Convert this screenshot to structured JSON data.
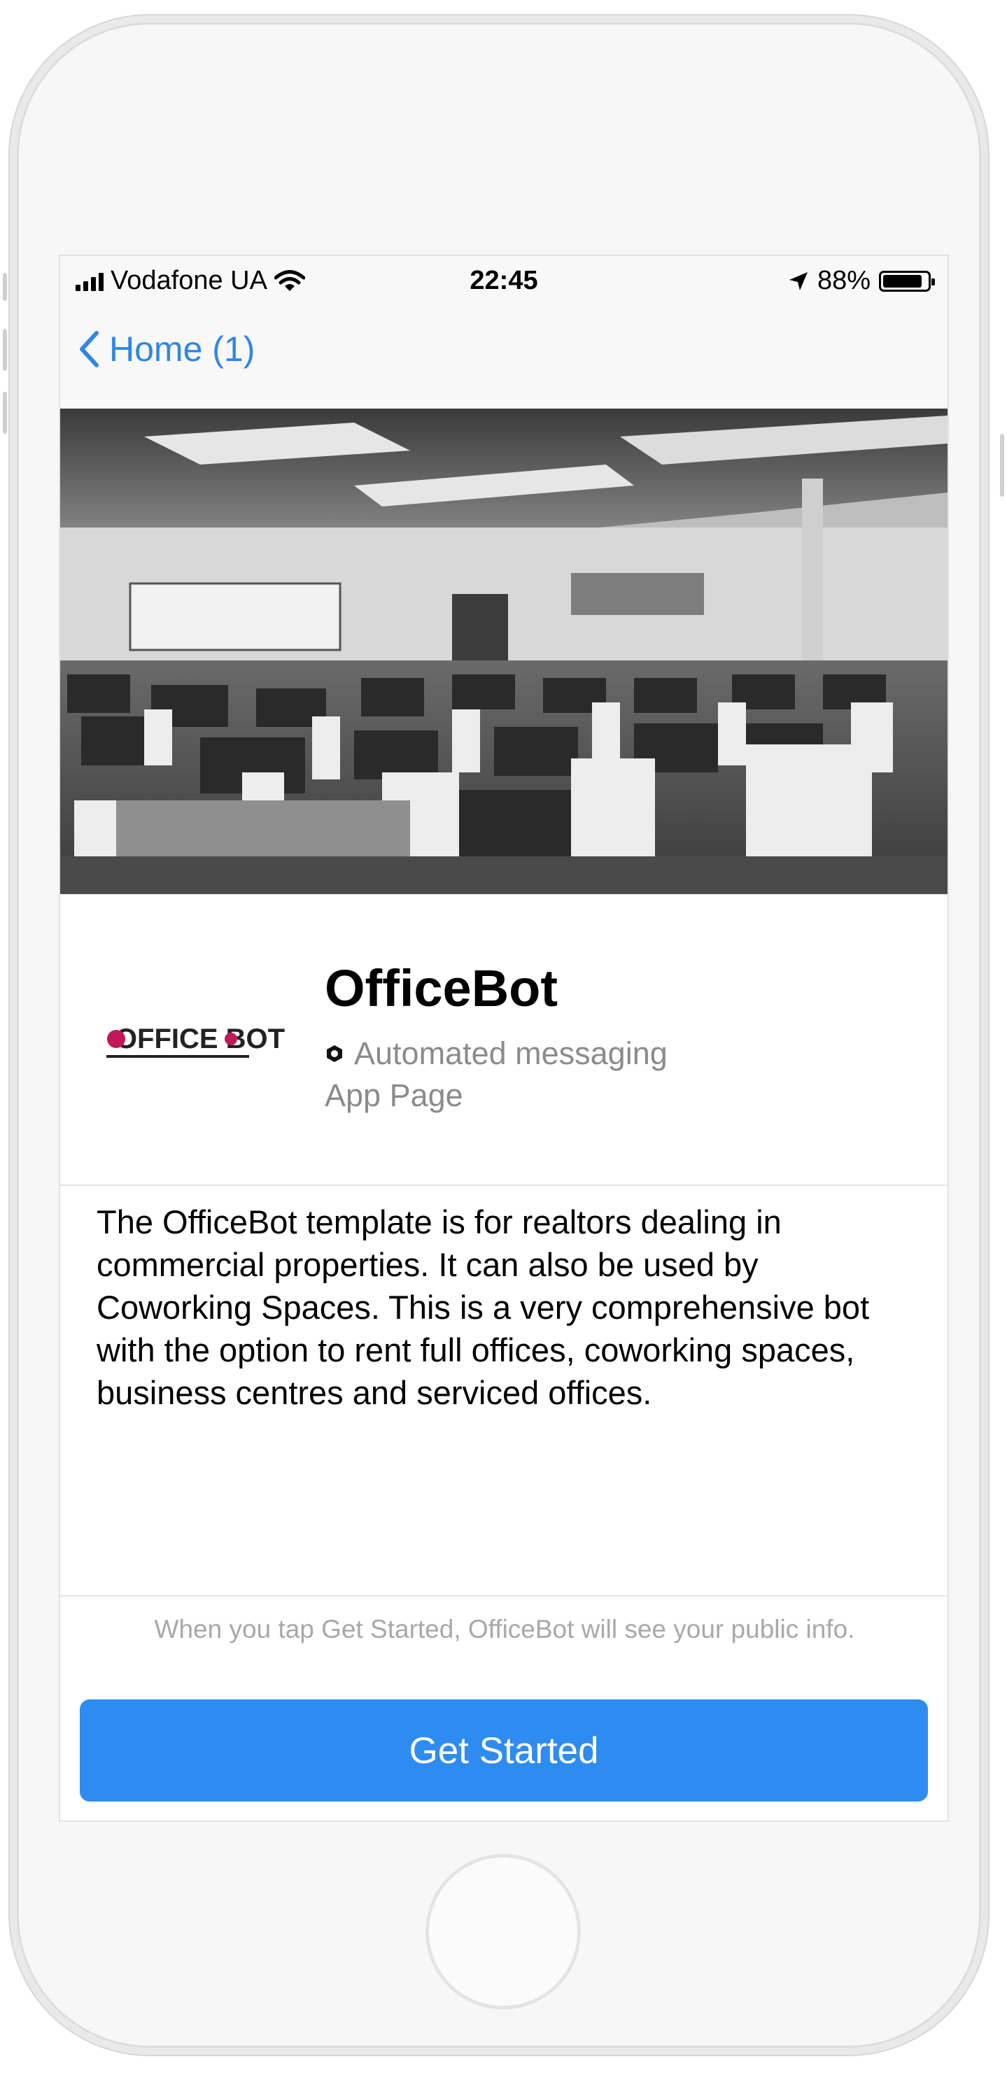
{
  "status_bar": {
    "carrier": "Vodafone UA",
    "time": "22:45",
    "battery_percent": "88%",
    "battery_level": 0.88
  },
  "nav": {
    "back_label": "Home (1)"
  },
  "profile": {
    "name": "OfficeBot",
    "tagline": "Automated messaging",
    "page_type": "App Page",
    "logo_text": "OFFICE BOT"
  },
  "description": "The OfficeBot template is for realtors dealing in commercial properties. It can also be used by Coworking Spaces. This is a very comprehensive bot with the option to rent full offices, coworking spaces, business centres and serviced offices.",
  "footer": {
    "disclaimer": "When you tap Get Started, OfficeBot will see your public info.",
    "button_label": "Get Started"
  },
  "colors": {
    "accent": "#2e8cf0",
    "link": "#2e86e8",
    "logo_accent": "#c2185b"
  }
}
